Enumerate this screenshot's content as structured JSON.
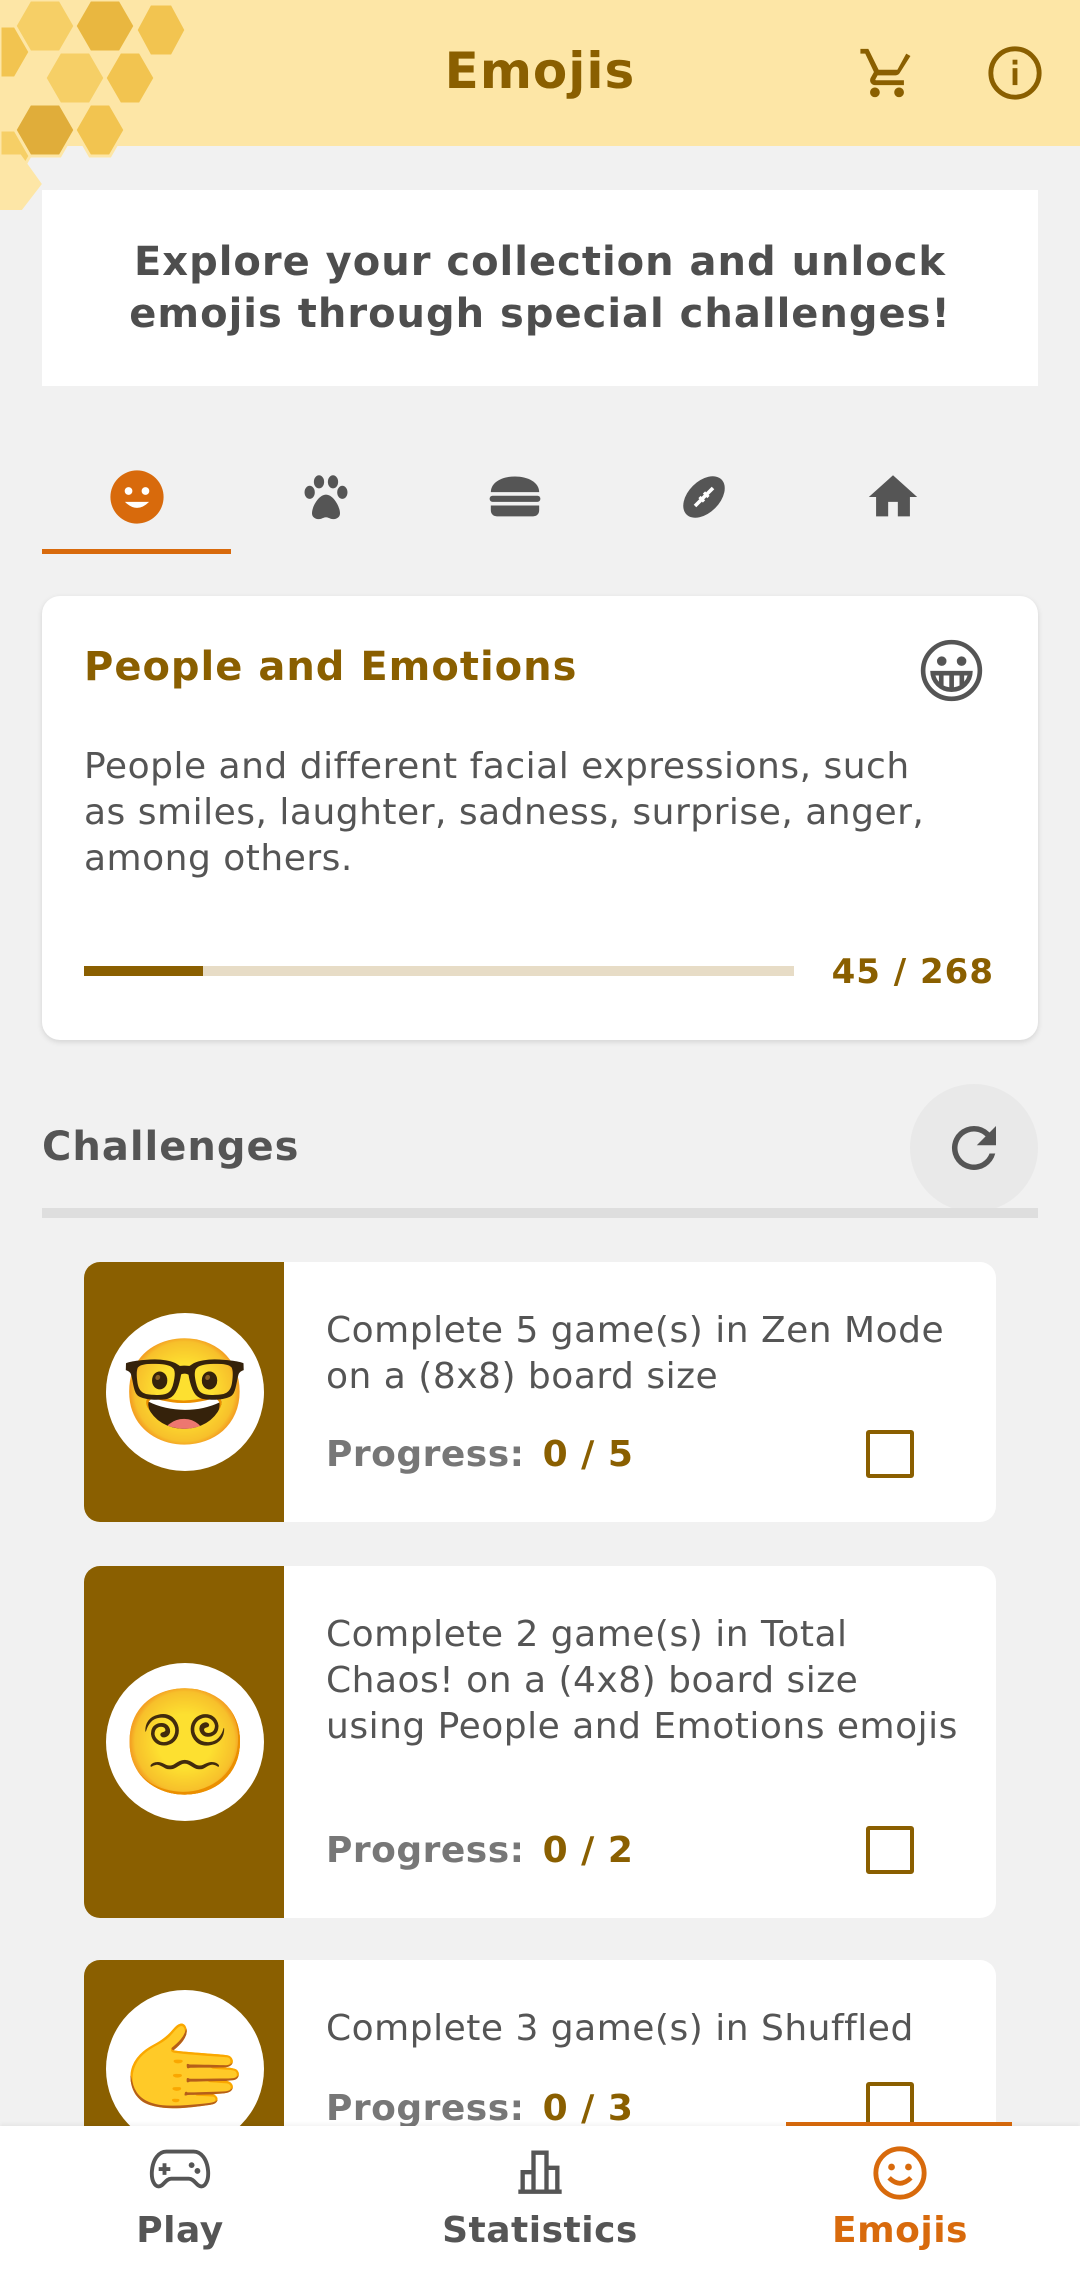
{
  "header": {
    "title": "Emojis",
    "cart_icon": "shopping-cart-icon",
    "info_icon": "info-icon",
    "accent_color": "#8a5f00",
    "background_color": "#fde6a6"
  },
  "intro": {
    "text": "Explore your collection and unlock emojis through special challenges!"
  },
  "tabs": [
    {
      "icon": "smiley-face-icon",
      "selected": true
    },
    {
      "icon": "paw-icon",
      "selected": false
    },
    {
      "icon": "burger-icon",
      "selected": false
    },
    {
      "icon": "football-icon",
      "selected": false
    },
    {
      "icon": "house-icon",
      "selected": false
    }
  ],
  "category": {
    "title": "People and Emotions",
    "emoji": "😀",
    "description": "People and different facial expressions, such as smiles, laughter, sadness, surprise, anger, among others.",
    "count": "45 / 268",
    "progress_fraction": 0.168
  },
  "challenges": {
    "title": "Challenges",
    "refresh_icon": "refresh-icon",
    "progress_label": "Progress:",
    "items": [
      {
        "emoji": "🤓",
        "text": "Complete 5 game(s)  in Zen Mode on a (8x8) board size",
        "progress": "0 / 5",
        "checked": false
      },
      {
        "emoji": "😵‍💫",
        "text": "Complete 2 game(s)  in Total Chaos! on a (4x8) board size using People and Emotions emojis",
        "progress": "0 / 2",
        "checked": false
      },
      {
        "emoji": "🫱",
        "text": "Complete 3 game(s)  in Shuffled",
        "progress": "0 / 3",
        "checked": false
      }
    ]
  },
  "nav": {
    "play": {
      "label": "Play",
      "icon": "gamepad-icon"
    },
    "statistics": {
      "label": "Statistics",
      "icon": "bar-chart-icon"
    },
    "emojis": {
      "label": "Emojis",
      "icon": "smiley-face-icon",
      "active": true
    }
  }
}
